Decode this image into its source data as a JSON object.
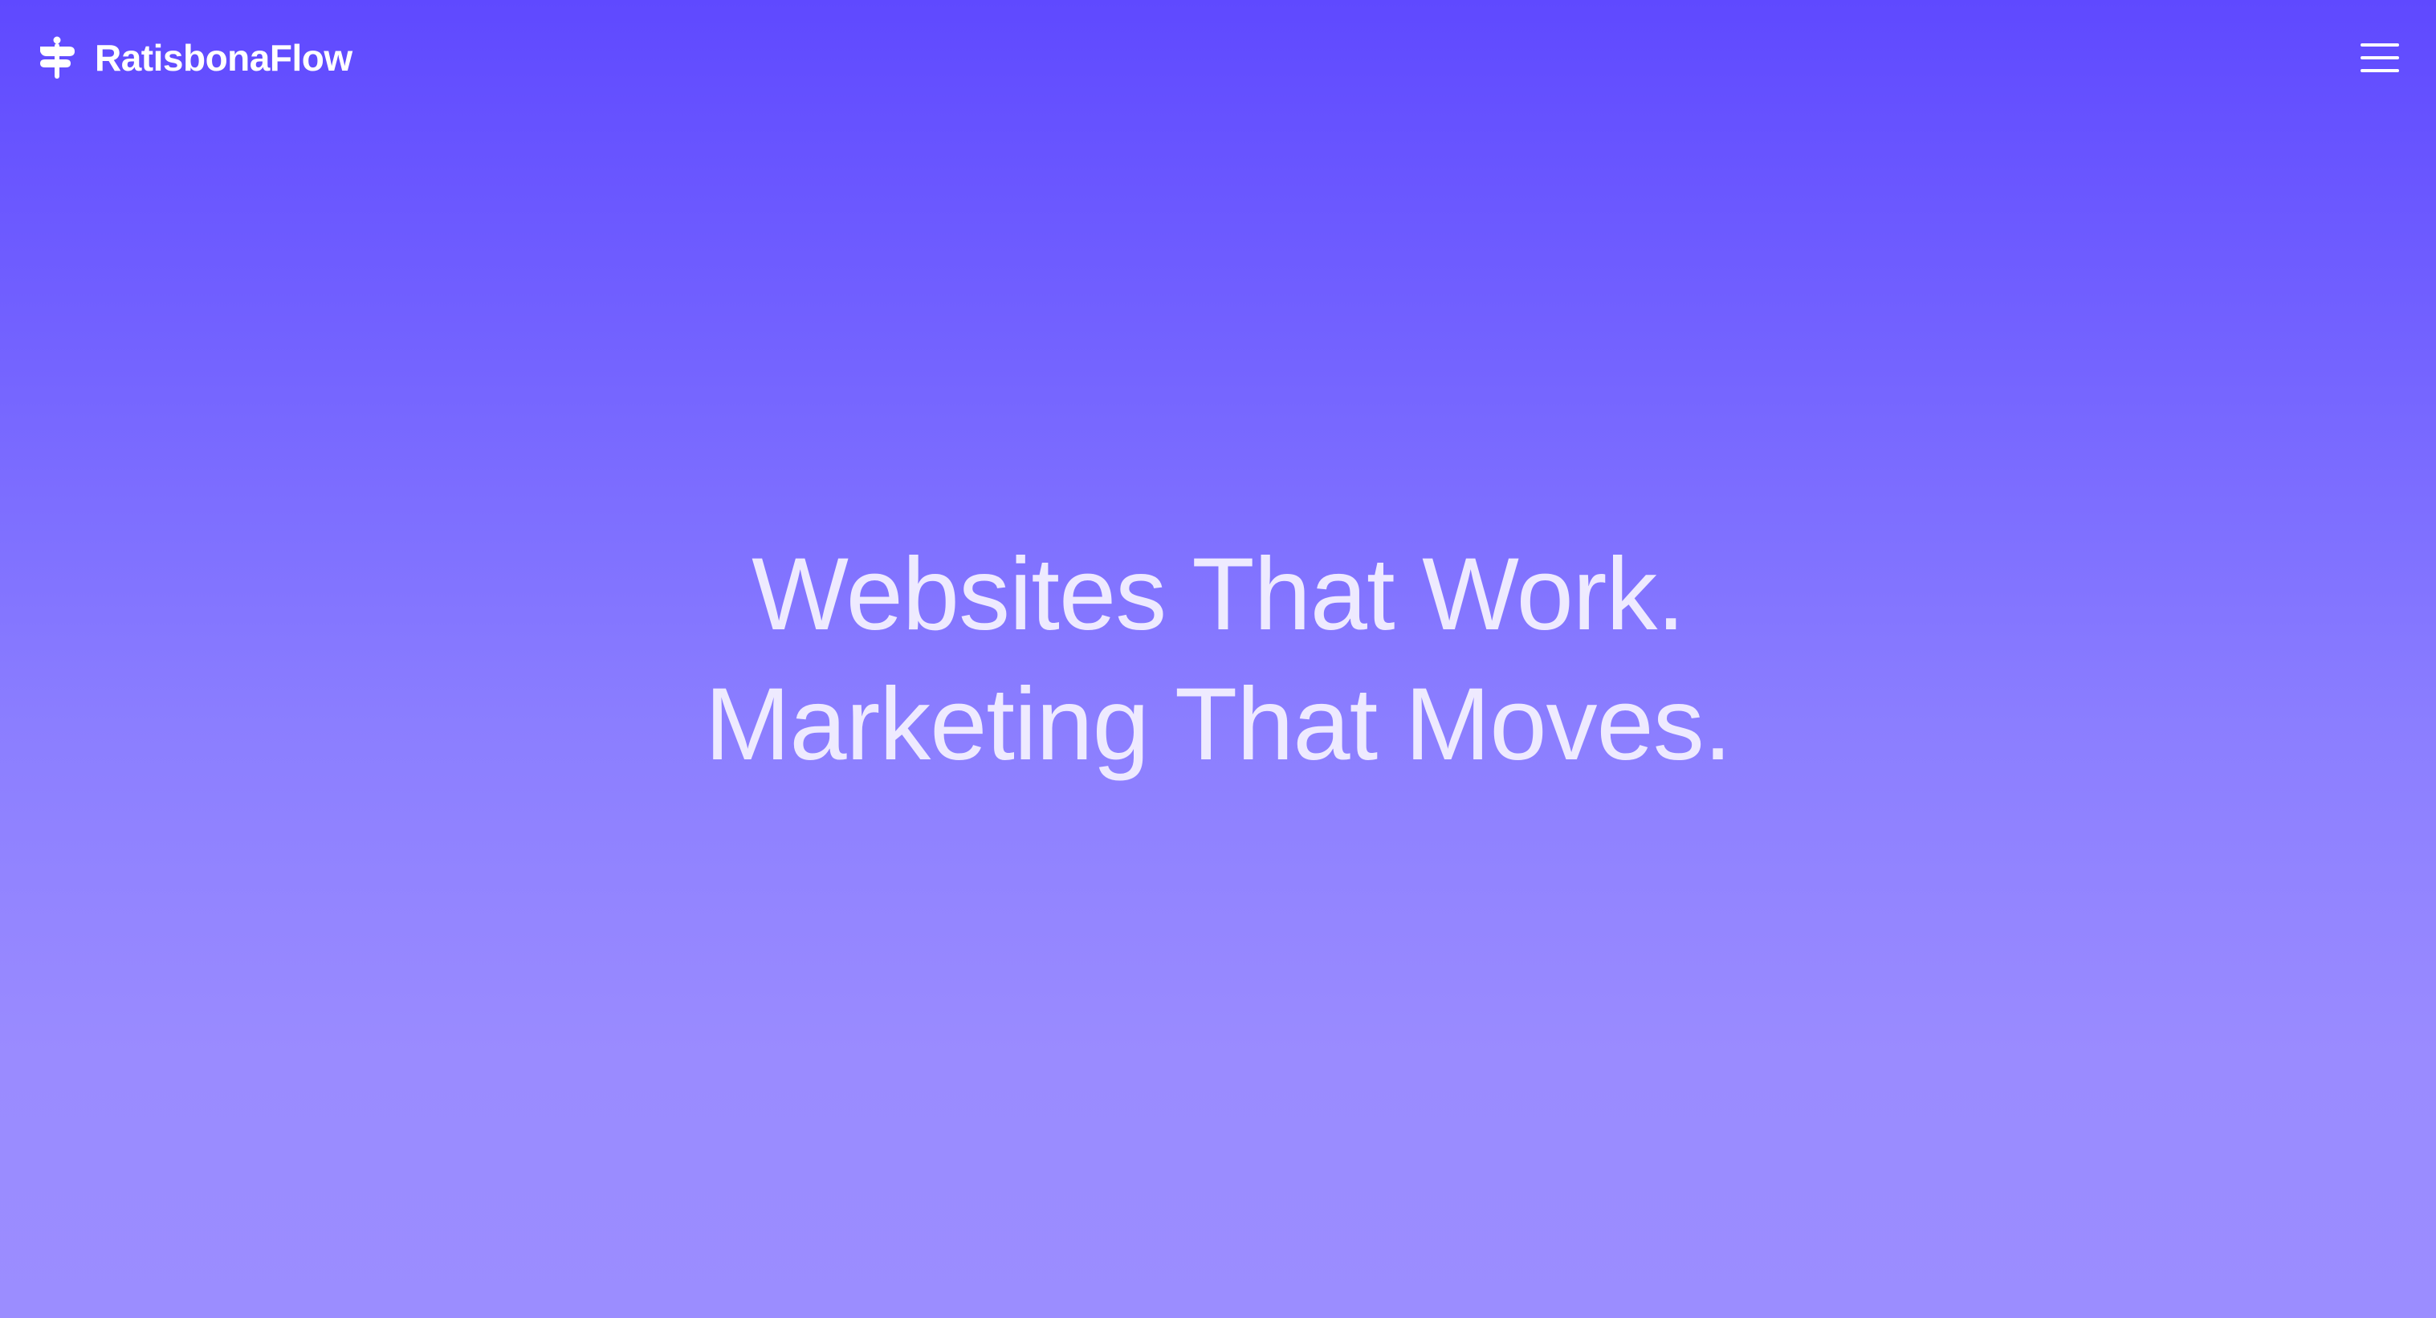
{
  "header": {
    "brand_name": "RatisbonaFlow",
    "logo_icon": "ratisbona-signpost-icon",
    "menu_icon": "hamburger-menu-icon"
  },
  "hero": {
    "headline_line_1": "Websites That Work.",
    "headline_line_2": "Marketing That Moves."
  },
  "colors": {
    "gradient_top": "#5f49ff",
    "gradient_bottom": "#9b8dff",
    "text": "#ffffff",
    "headline_text": "#eeeaff"
  }
}
